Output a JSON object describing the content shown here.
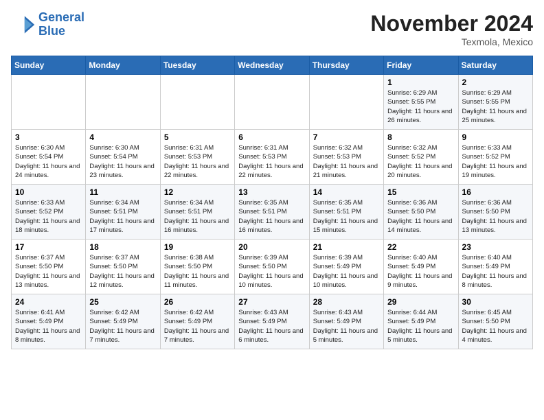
{
  "header": {
    "logo_line1": "General",
    "logo_line2": "Blue",
    "month": "November 2024",
    "location": "Texmola, Mexico"
  },
  "days_of_week": [
    "Sunday",
    "Monday",
    "Tuesday",
    "Wednesday",
    "Thursday",
    "Friday",
    "Saturday"
  ],
  "weeks": [
    [
      {
        "day": "",
        "info": ""
      },
      {
        "day": "",
        "info": ""
      },
      {
        "day": "",
        "info": ""
      },
      {
        "day": "",
        "info": ""
      },
      {
        "day": "",
        "info": ""
      },
      {
        "day": "1",
        "info": "Sunrise: 6:29 AM\nSunset: 5:55 PM\nDaylight: 11 hours and 26 minutes."
      },
      {
        "day": "2",
        "info": "Sunrise: 6:29 AM\nSunset: 5:55 PM\nDaylight: 11 hours and 25 minutes."
      }
    ],
    [
      {
        "day": "3",
        "info": "Sunrise: 6:30 AM\nSunset: 5:54 PM\nDaylight: 11 hours and 24 minutes."
      },
      {
        "day": "4",
        "info": "Sunrise: 6:30 AM\nSunset: 5:54 PM\nDaylight: 11 hours and 23 minutes."
      },
      {
        "day": "5",
        "info": "Sunrise: 6:31 AM\nSunset: 5:53 PM\nDaylight: 11 hours and 22 minutes."
      },
      {
        "day": "6",
        "info": "Sunrise: 6:31 AM\nSunset: 5:53 PM\nDaylight: 11 hours and 22 minutes."
      },
      {
        "day": "7",
        "info": "Sunrise: 6:32 AM\nSunset: 5:53 PM\nDaylight: 11 hours and 21 minutes."
      },
      {
        "day": "8",
        "info": "Sunrise: 6:32 AM\nSunset: 5:52 PM\nDaylight: 11 hours and 20 minutes."
      },
      {
        "day": "9",
        "info": "Sunrise: 6:33 AM\nSunset: 5:52 PM\nDaylight: 11 hours and 19 minutes."
      }
    ],
    [
      {
        "day": "10",
        "info": "Sunrise: 6:33 AM\nSunset: 5:52 PM\nDaylight: 11 hours and 18 minutes."
      },
      {
        "day": "11",
        "info": "Sunrise: 6:34 AM\nSunset: 5:51 PM\nDaylight: 11 hours and 17 minutes."
      },
      {
        "day": "12",
        "info": "Sunrise: 6:34 AM\nSunset: 5:51 PM\nDaylight: 11 hours and 16 minutes."
      },
      {
        "day": "13",
        "info": "Sunrise: 6:35 AM\nSunset: 5:51 PM\nDaylight: 11 hours and 16 minutes."
      },
      {
        "day": "14",
        "info": "Sunrise: 6:35 AM\nSunset: 5:51 PM\nDaylight: 11 hours and 15 minutes."
      },
      {
        "day": "15",
        "info": "Sunrise: 6:36 AM\nSunset: 5:50 PM\nDaylight: 11 hours and 14 minutes."
      },
      {
        "day": "16",
        "info": "Sunrise: 6:36 AM\nSunset: 5:50 PM\nDaylight: 11 hours and 13 minutes."
      }
    ],
    [
      {
        "day": "17",
        "info": "Sunrise: 6:37 AM\nSunset: 5:50 PM\nDaylight: 11 hours and 13 minutes."
      },
      {
        "day": "18",
        "info": "Sunrise: 6:37 AM\nSunset: 5:50 PM\nDaylight: 11 hours and 12 minutes."
      },
      {
        "day": "19",
        "info": "Sunrise: 6:38 AM\nSunset: 5:50 PM\nDaylight: 11 hours and 11 minutes."
      },
      {
        "day": "20",
        "info": "Sunrise: 6:39 AM\nSunset: 5:50 PM\nDaylight: 11 hours and 10 minutes."
      },
      {
        "day": "21",
        "info": "Sunrise: 6:39 AM\nSunset: 5:49 PM\nDaylight: 11 hours and 10 minutes."
      },
      {
        "day": "22",
        "info": "Sunrise: 6:40 AM\nSunset: 5:49 PM\nDaylight: 11 hours and 9 minutes."
      },
      {
        "day": "23",
        "info": "Sunrise: 6:40 AM\nSunset: 5:49 PM\nDaylight: 11 hours and 8 minutes."
      }
    ],
    [
      {
        "day": "24",
        "info": "Sunrise: 6:41 AM\nSunset: 5:49 PM\nDaylight: 11 hours and 8 minutes."
      },
      {
        "day": "25",
        "info": "Sunrise: 6:42 AM\nSunset: 5:49 PM\nDaylight: 11 hours and 7 minutes."
      },
      {
        "day": "26",
        "info": "Sunrise: 6:42 AM\nSunset: 5:49 PM\nDaylight: 11 hours and 7 minutes."
      },
      {
        "day": "27",
        "info": "Sunrise: 6:43 AM\nSunset: 5:49 PM\nDaylight: 11 hours and 6 minutes."
      },
      {
        "day": "28",
        "info": "Sunrise: 6:43 AM\nSunset: 5:49 PM\nDaylight: 11 hours and 5 minutes."
      },
      {
        "day": "29",
        "info": "Sunrise: 6:44 AM\nSunset: 5:49 PM\nDaylight: 11 hours and 5 minutes."
      },
      {
        "day": "30",
        "info": "Sunrise: 6:45 AM\nSunset: 5:50 PM\nDaylight: 11 hours and 4 minutes."
      }
    ]
  ]
}
